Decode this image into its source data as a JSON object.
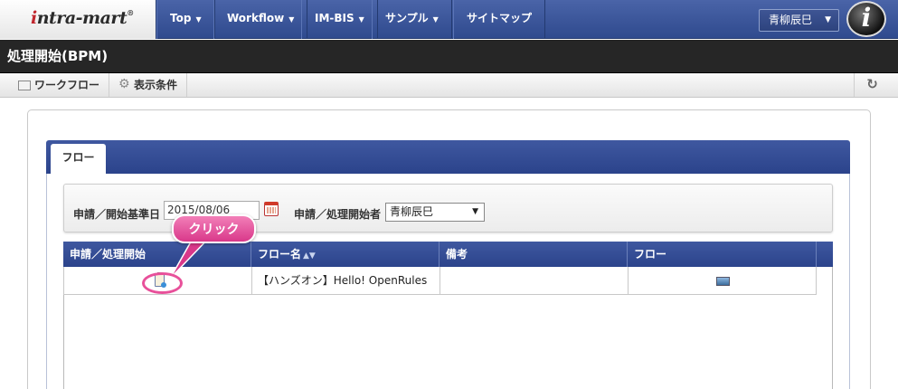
{
  "header": {
    "logo_i": "i",
    "logo_text": "ntra-mart",
    "logo_reg": "®",
    "nav": [
      {
        "label": "Top"
      },
      {
        "label": "Workflow"
      },
      {
        "label": "IM-BIS"
      },
      {
        "label": "サンプル"
      },
      {
        "label": "サイトマップ"
      }
    ],
    "user_name": "青柳辰巳",
    "badge_letter": "i"
  },
  "page": {
    "title": "処理開始(BPM)"
  },
  "toolbar": {
    "workflow_label": "ワークフロー",
    "display_conditions_label": "表示条件"
  },
  "tabs": [
    {
      "label": "フロー",
      "active": true
    }
  ],
  "search": {
    "base_date_label": "申請／開始基準日",
    "base_date_value": "2015/08/06",
    "starter_label": "申請／処理開始者",
    "starter_value": "青柳辰巳"
  },
  "table": {
    "columns": [
      {
        "label": "申請／処理開始"
      },
      {
        "label": "フロー名",
        "sortable": true
      },
      {
        "label": "備考"
      },
      {
        "label": "フロー"
      }
    ],
    "rows": [
      {
        "flow_name": "【ハンズオン】Hello! OpenRules",
        "note": ""
      }
    ]
  },
  "callout": {
    "label": "クリック",
    "color": "#e8509a"
  },
  "icons": {
    "start_icon": "clipboard-start-icon",
    "flow_icon": "flow-diagram-icon",
    "calendar_icon": "calendar-icon",
    "refresh_icon": "refresh-icon"
  },
  "colors": {
    "nav_bg": "#3a539a",
    "title_bg": "#262626",
    "header_blue": "#2f4a8e"
  }
}
